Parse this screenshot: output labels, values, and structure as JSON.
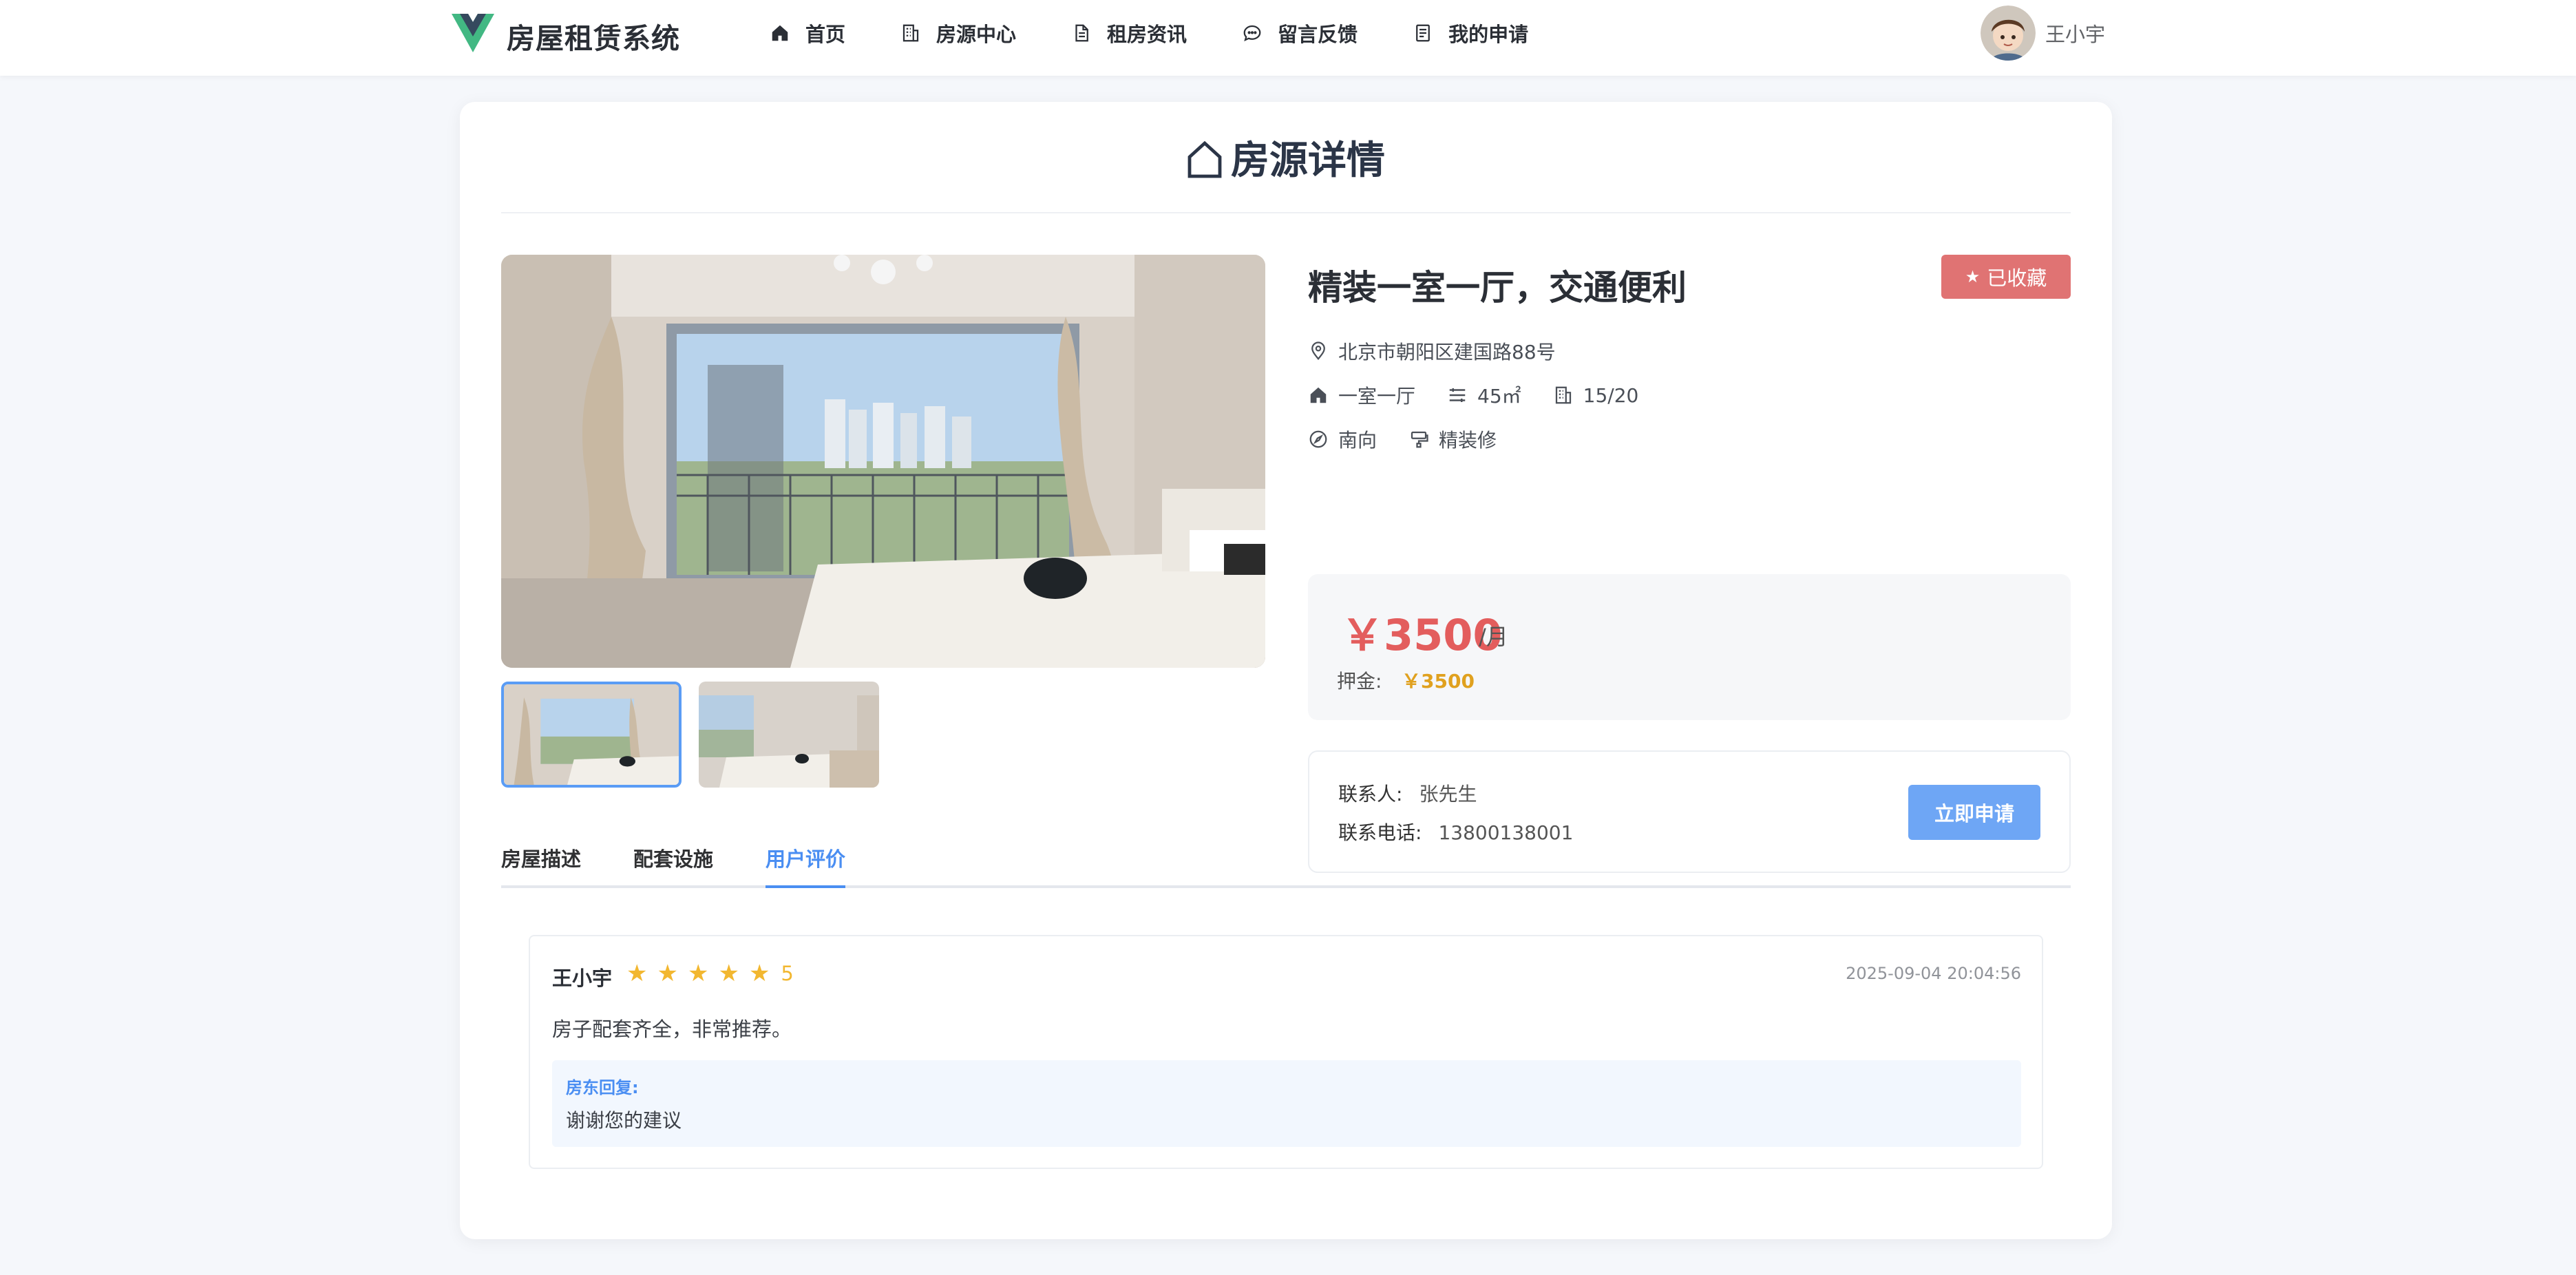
{
  "header": {
    "brand": "房屋租赁系统",
    "nav": [
      {
        "label": "首页",
        "icon": "home-icon"
      },
      {
        "label": "房源中心",
        "icon": "building-icon"
      },
      {
        "label": "租房资讯",
        "icon": "document-icon"
      },
      {
        "label": "留言反馈",
        "icon": "chat-icon"
      },
      {
        "label": "我的申请",
        "icon": "clipboard-icon"
      }
    ],
    "user_name": "王小宇"
  },
  "page": {
    "title": "房源详情"
  },
  "house": {
    "title": "精装一室一厅，交通便利",
    "favorite_label": "已收藏",
    "address": "北京市朝阳区建国路88号",
    "layout": "一室一厅",
    "area": "45㎡",
    "floor": "15/20",
    "orientation": "南向",
    "decoration": "精装修",
    "price": "￥3500",
    "price_unit": "/月",
    "deposit_label": "押金:",
    "deposit": "￥3500",
    "contact_label": "联系人:",
    "contact": "张先生",
    "phone_label": "联系电话:",
    "phone": "13800138001",
    "apply_label": "立即申请"
  },
  "tabs": [
    {
      "label": "房屋描述",
      "active": false
    },
    {
      "label": "配套设施",
      "active": false
    },
    {
      "label": "用户评价",
      "active": true
    }
  ],
  "review": {
    "user": "王小宇",
    "rating": 5,
    "score": "5",
    "time": "2025-09-04 20:04:56",
    "text": "房子配套齐全，非常推荐。",
    "reply_label": "房东回复:",
    "reply_text": "谢谢您的建议"
  },
  "colors": {
    "accent": "#4a8ef2",
    "favorite": "#e07373",
    "price": "#e35d5d",
    "star": "#f2b730"
  }
}
